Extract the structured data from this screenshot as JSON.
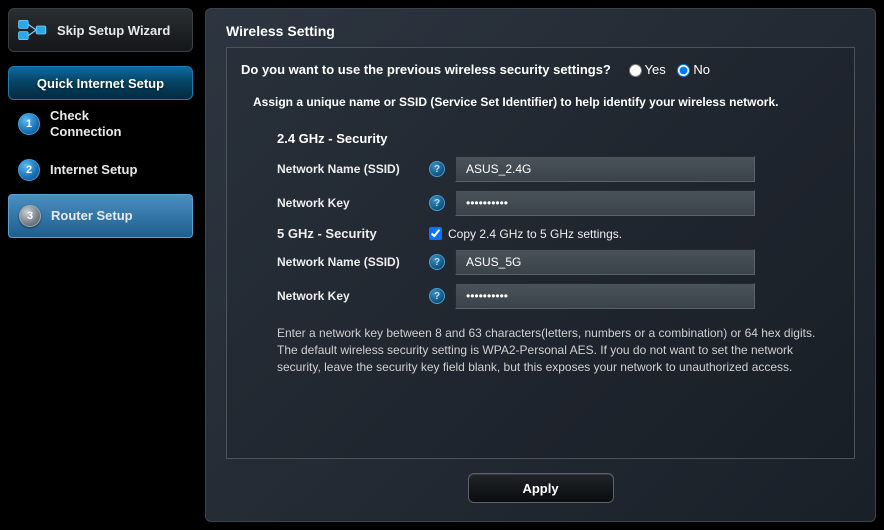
{
  "sidebar": {
    "skip_label": "Skip Setup Wizard",
    "qis_title": "Quick Internet Setup",
    "steps": [
      {
        "num": "1",
        "label": "Check Connection"
      },
      {
        "num": "2",
        "label": "Internet Setup"
      },
      {
        "num": "3",
        "label": "Router Setup"
      }
    ]
  },
  "main": {
    "title": "Wireless Setting",
    "question": "Do you want to use the previous wireless security settings?",
    "opt_yes": "Yes",
    "opt_no": "No",
    "instruction": "Assign a unique name or SSID (Service Set Identifier) to help identify your wireless network.",
    "section24": "2.4 GHz - Security",
    "ssid_label": "Network Name (SSID)",
    "key_label": "Network Key",
    "ssid24_value": "ASUS_2.4G",
    "key24_value": "••••••••••",
    "section5": "5 GHz - Security",
    "copy_label": "Copy 2.4 GHz to 5 GHz settings.",
    "ssid5_value": "ASUS_5G",
    "key5_value": "••••••••••",
    "note": "Enter a network key between 8 and 63 characters(letters, numbers or a combination) or 64 hex digits. The default wireless security setting is WPA2-Personal AES. If you do not want to set the network security, leave the security key field blank, but this exposes your network to unauthorized access.",
    "apply": "Apply"
  }
}
